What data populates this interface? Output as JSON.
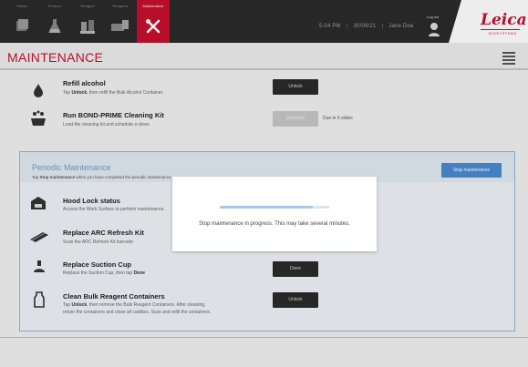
{
  "tabs": [
    {
      "label": "Status",
      "icon": "slide-tray-icon"
    },
    {
      "label": "Protocol",
      "icon": "flask-icon"
    },
    {
      "label": "Reagent",
      "icon": "reagent-bottles-icon"
    },
    {
      "label": "Reagents",
      "icon": "reagent-setup-icon"
    },
    {
      "label": "Maintenance",
      "icon": "tools-icon"
    }
  ],
  "status": {
    "time": "5:04 PM",
    "date": "30/09/21",
    "user": "Jane Doe"
  },
  "logout_label": "Log out",
  "logo": {
    "text": "Leica",
    "sub": "BIOSYSTEMS"
  },
  "page_title": "MAINTENANCE",
  "tasks": [
    {
      "title": "Refill alcohol",
      "desc_pre": "Tap ",
      "desc_bold": "Unlock",
      "desc_post": ", then refill the Bulk Alcohol Container.",
      "button": "Unlock",
      "icon": "alcohol-drop-icon"
    },
    {
      "title": "Run BOND-PRIME Cleaning Kit",
      "desc_pre": "Load the cleaning kit and schedule a clean.",
      "desc_bold": "",
      "desc_post": "",
      "button": "Schedule",
      "note": "Due in 5 slides",
      "icon": "cleaning-kit-icon"
    }
  ],
  "periodic": {
    "title": "Periodic Maintenance",
    "desc_pre": "Tap ",
    "desc_bold": "Stop maintenance",
    "desc_post": " when you have completed the periodic maintenance.",
    "stop_button": "Stop maintenance",
    "items": [
      {
        "title": "Hood Lock status",
        "desc": "Access the Work Surface to perform maintenance.",
        "icon": "hood-lock-icon"
      },
      {
        "title": "Replace ARC Refresh Kit",
        "desc": "Scan the ARC Refresh Kit barcode",
        "icon": "arc-kit-icon"
      },
      {
        "title": "Replace Suction Cup",
        "desc_pre": "Replace the Suction Cup, then tap ",
        "desc_bold": "Done",
        "button": "Done",
        "icon": "suction-cup-icon"
      },
      {
        "title": "Clean Bulk Reagent Containers",
        "desc_pre": "Tap ",
        "desc_bold": "Unlock",
        "desc_post": ", then remove the Bulk Reagent Containers. After cleaning,",
        "desc2": "return the containers and close all caddies. Scan and refill the containers.",
        "button": "Unlock",
        "icon": "container-icon"
      }
    ]
  },
  "modal": {
    "message": "Stop maintenance in progress. This may take several minutes.",
    "progress": 0.85
  },
  "colors": {
    "accent": "#c8102e",
    "topbar": "#2b2b2b",
    "periodic_blue": "#4a8ad0"
  }
}
